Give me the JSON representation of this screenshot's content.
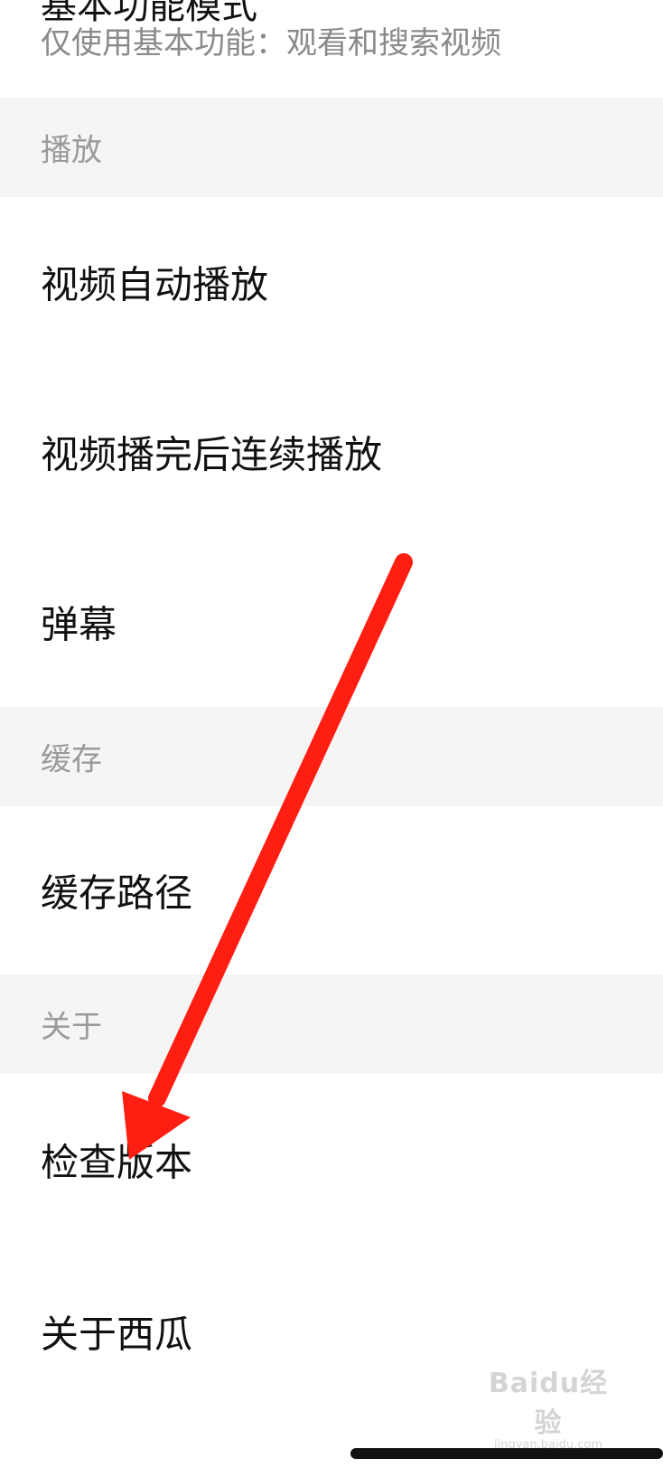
{
  "top_item": {
    "title_partial": "基本功能模式",
    "subtitle": "仅使用基本功能：观看和搜索视频"
  },
  "sections": {
    "playback": {
      "header": "播放",
      "items": [
        "视频自动播放",
        "视频播完后连续播放",
        "弹幕"
      ]
    },
    "cache": {
      "header": "缓存",
      "items": [
        "缓存路径"
      ]
    },
    "about": {
      "header": "关于",
      "items": [
        "检查版本",
        "关于西瓜"
      ]
    }
  },
  "annotation": {
    "arrow_color": "#ff1e12"
  },
  "watermark": {
    "logo": "Baidu经验",
    "url": "jingyan.baidu.com"
  }
}
